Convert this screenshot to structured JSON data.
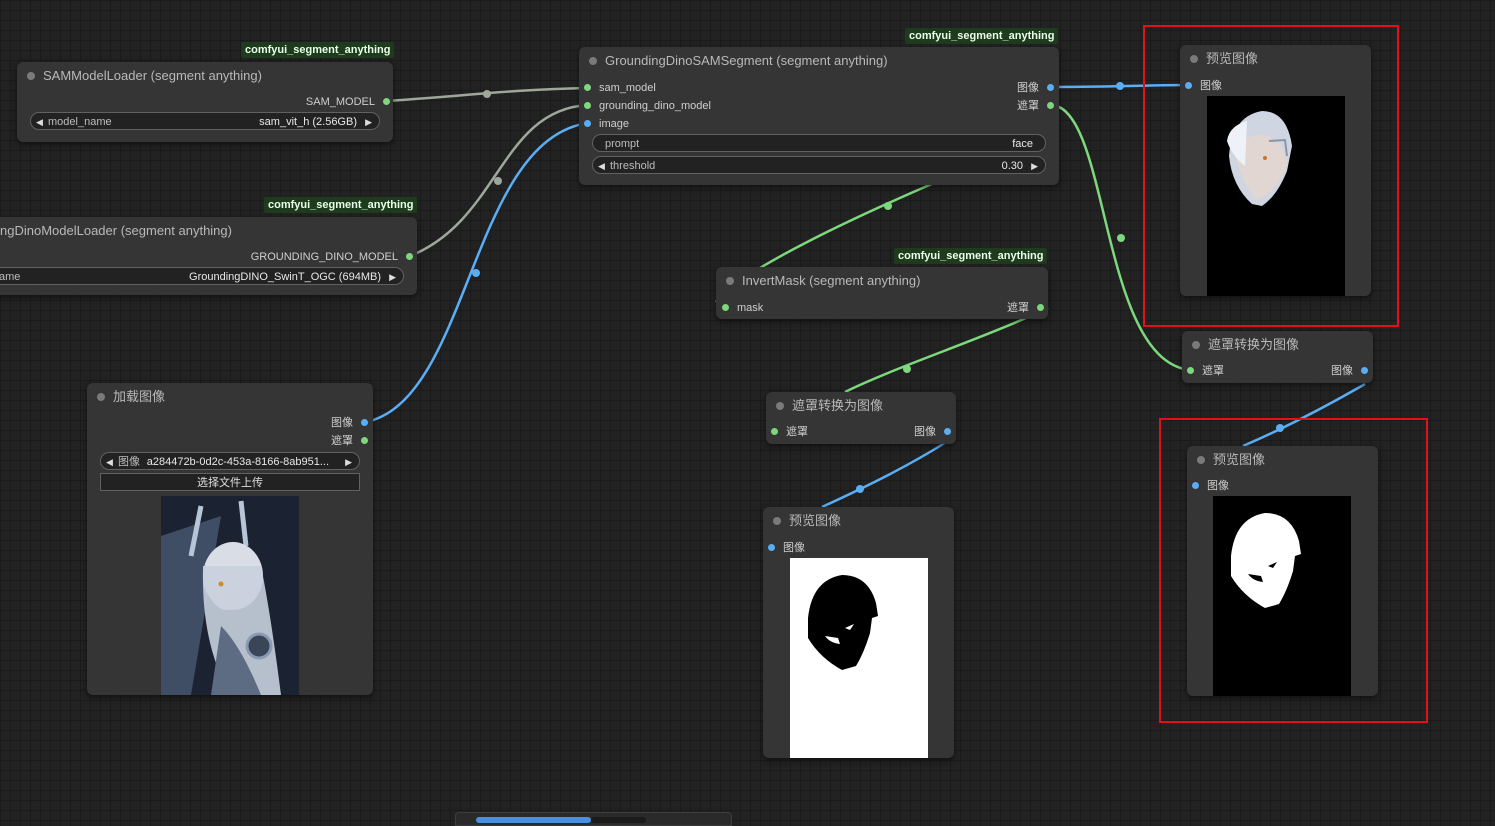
{
  "badges": {
    "b1": "comfyui_segment_anything",
    "b2": "comfyui_segment_anything",
    "b3": "comfyui_segment_anything",
    "b4": "comfyui_segment_anything"
  },
  "sam_loader": {
    "title": "SAMModelLoader (segment anything)",
    "output": "SAM_MODEL",
    "widget_label": "model_name",
    "widget_value": "sam_vit_h (2.56GB)"
  },
  "dino_loader": {
    "title": "ngDinoModelLoader (segment anything)",
    "output": "GROUNDING_DINO_MODEL",
    "widget_label": "ame",
    "widget_value": "GroundingDINO_SwinT_OGC (694MB)"
  },
  "load_image": {
    "title": "加载图像",
    "out_image": "图像",
    "out_mask": "遮罩",
    "widget_label": "图像",
    "widget_value": "a284472b-0d2c-453a-8166-8ab951...",
    "upload_button": "选择文件上传"
  },
  "sam_segment": {
    "title": "GroundingDinoSAMSegment (segment anything)",
    "in_sam": "sam_model",
    "in_dino": "grounding_dino_model",
    "in_image": "image",
    "out_image": "图像",
    "out_mask": "遮罩",
    "prompt_label": "prompt",
    "prompt_value": "face",
    "threshold_label": "threshold",
    "threshold_value": "0.30"
  },
  "invert_mask": {
    "title": "InvertMask (segment anything)",
    "in_mask": "mask",
    "out_mask": "遮罩"
  },
  "mask_to_image_1": {
    "title": "遮罩转换为图像",
    "in_mask": "遮罩",
    "out_image": "图像"
  },
  "mask_to_image_2": {
    "title": "遮罩转换为图像",
    "in_mask": "遮罩",
    "out_image": "图像"
  },
  "preview_1": {
    "title": "预览图像",
    "in_image": "图像"
  },
  "preview_2": {
    "title": "预览图像",
    "in_image": "图像"
  },
  "preview_3": {
    "title": "预览图像",
    "in_image": "图像"
  },
  "colors": {
    "image_link": "#5aaef5",
    "mask_link": "#7dd87d",
    "model_link": "#9ea89a",
    "highlight": "#e0111b",
    "badge_bg": "#1e3b1e"
  }
}
